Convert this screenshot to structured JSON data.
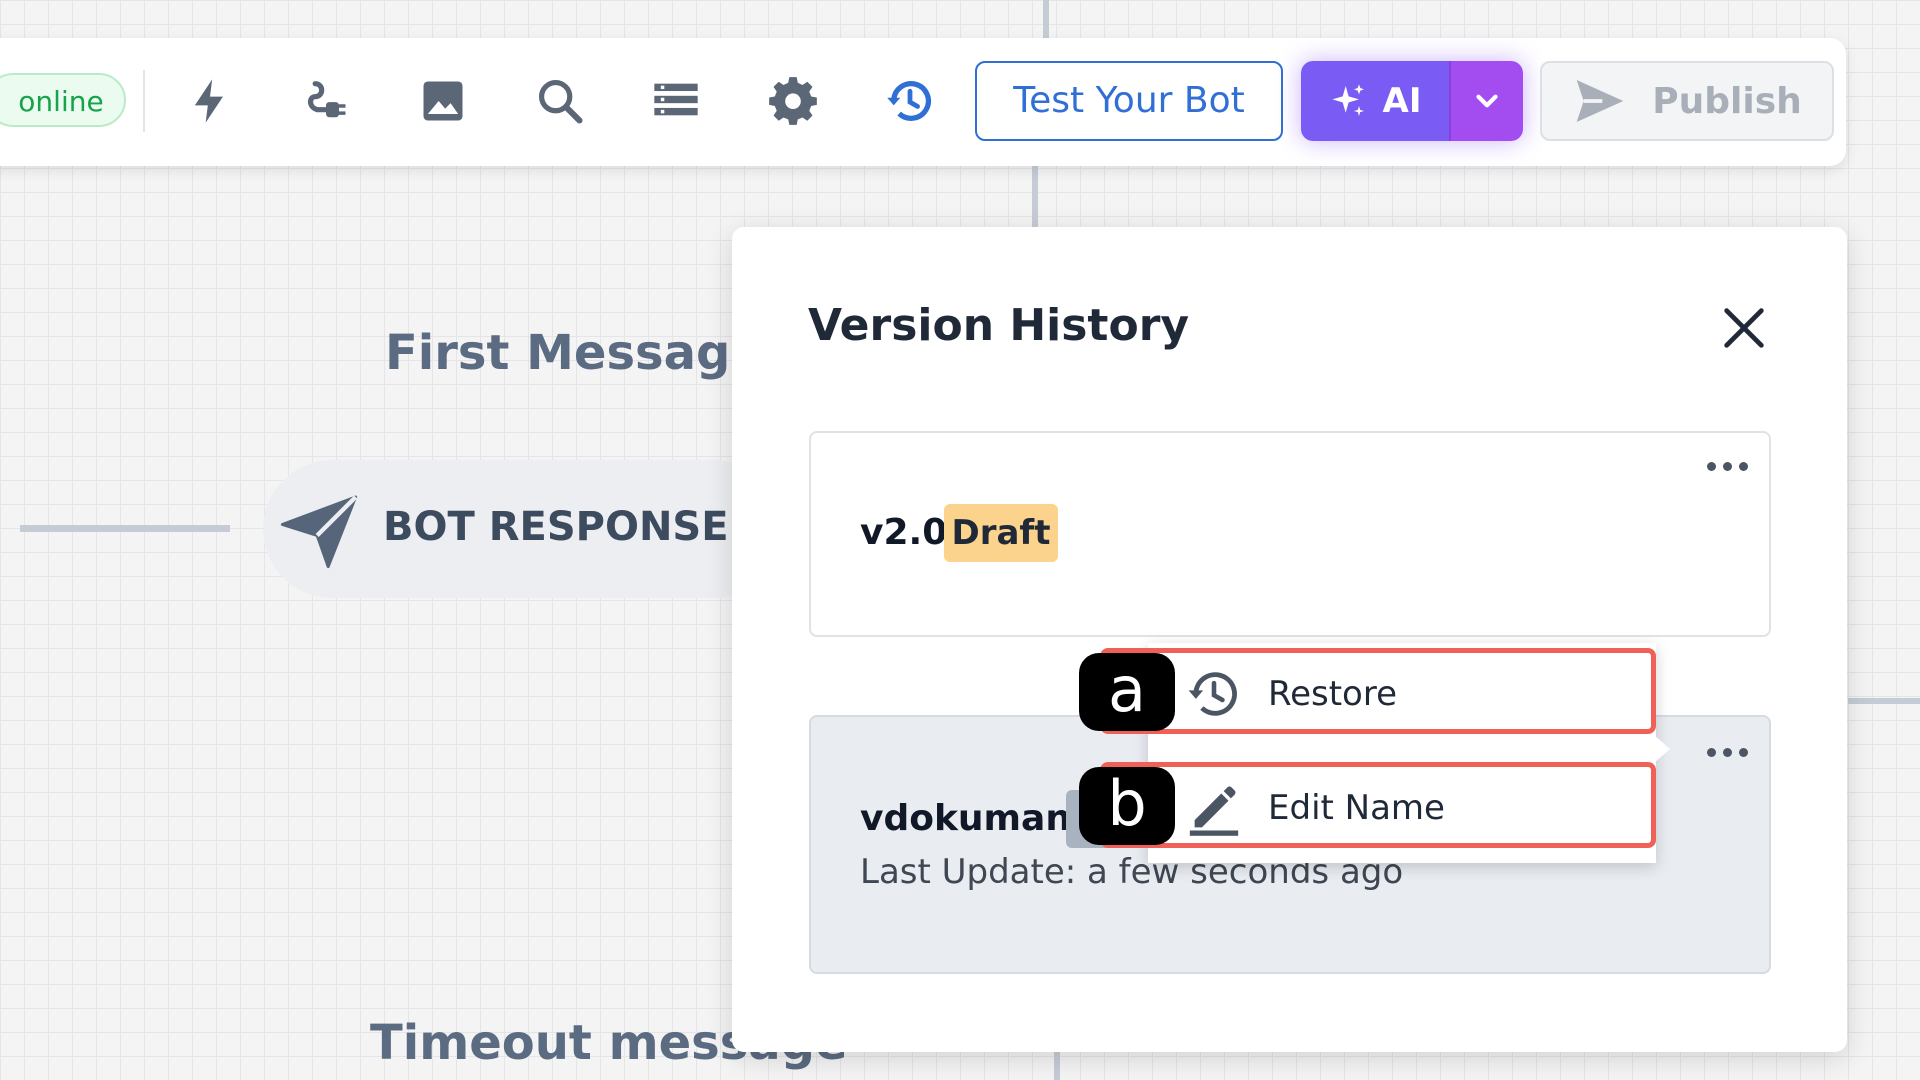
{
  "toolbar": {
    "status": "online",
    "icons": [
      "bolt-icon",
      "plug-icon",
      "image-icon",
      "search-icon",
      "list-icon",
      "gear-icon",
      "history-icon"
    ],
    "test_button": "Test Your Bot",
    "ai_button": "AI",
    "publish_button": "Publish"
  },
  "canvas": {
    "first_message_label": "First Message",
    "bot_response_label": "BOT RESPONSE",
    "timeout_label": "Timeout message"
  },
  "version_panel": {
    "title": "Version History",
    "close_label": "X",
    "versions": [
      {
        "name": "v2.0",
        "badge": "Draft"
      },
      {
        "name": "vdokuman",
        "updated": "Last Update: a few seconds ago"
      }
    ]
  },
  "context_menu": {
    "items": [
      {
        "label": "Restore",
        "icon": "restore-icon",
        "marker": "a"
      },
      {
        "label": "Edit Name",
        "icon": "pencil-icon",
        "marker": "b"
      }
    ]
  },
  "colors": {
    "primary_blue": "#2f6fd6",
    "ai_purple": "#7a5cf5",
    "highlight_red": "#ef6157",
    "draft_amber": "#fbd38d"
  }
}
